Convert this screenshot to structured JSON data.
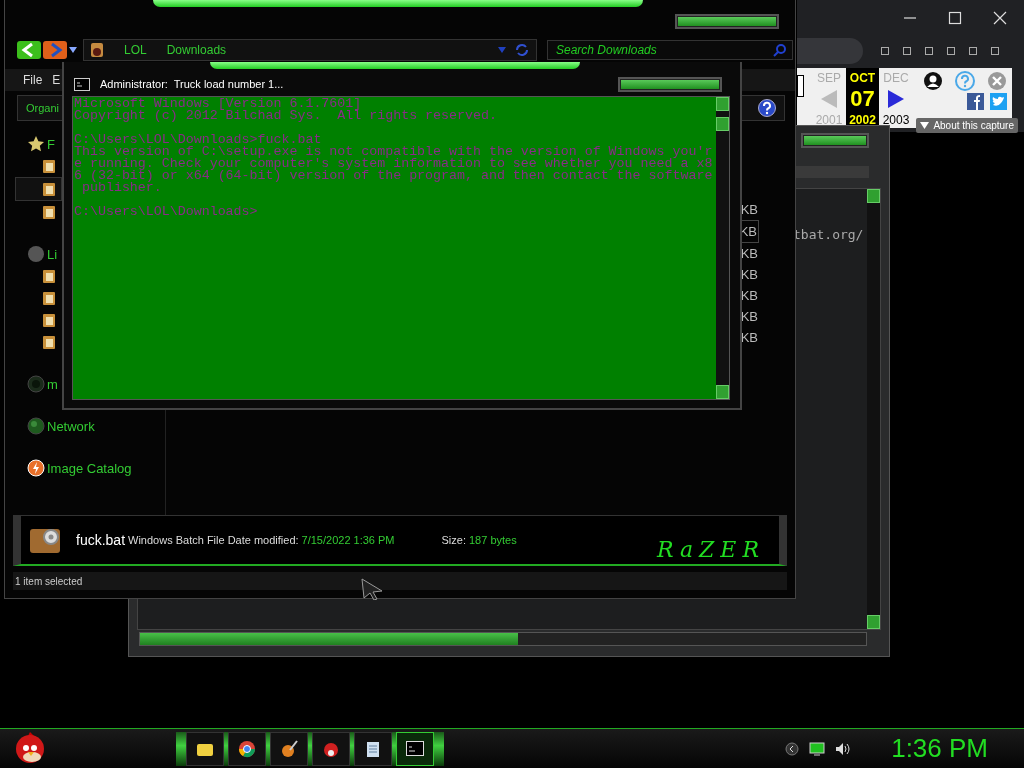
{
  "browser": {
    "wayback": {
      "months": [
        {
          "label": "SEP",
          "selected": false
        },
        {
          "label": "OCT",
          "selected": true
        },
        {
          "label": "DEC",
          "selected": false
        }
      ],
      "day": "07",
      "years": [
        {
          "label": "2001",
          "selected": false
        },
        {
          "label": "2002",
          "selected": true
        },
        {
          "label": "2003",
          "selected": false
        }
      ],
      "about": "About this capture"
    }
  },
  "back_window": {
    "text": "tbat.org/"
  },
  "explorer": {
    "address": [
      "LOL",
      "Downloads"
    ],
    "search": {
      "placeholder": "Search Downloads"
    },
    "menu": [
      "File",
      "E"
    ],
    "toolbar": [
      "Organi"
    ],
    "sidebar": [
      {
        "label": "F",
        "kind": "favorites",
        "items": [
          {
            "selected": false
          },
          {
            "selected": true
          },
          {
            "selected": false
          }
        ]
      },
      {
        "label": "Li",
        "kind": "libraries",
        "items": [
          {
            "selected": false
          },
          {
            "selected": false
          },
          {
            "selected": false
          },
          {
            "selected": false
          }
        ]
      },
      {
        "label": "m",
        "kind": "homegroup"
      },
      {
        "label": "Network",
        "kind": "network"
      },
      {
        "label": "Image Catalog",
        "kind": "catalog"
      }
    ],
    "sizes": [
      {
        "text": "KB",
        "selected": false
      },
      {
        "text": "KB",
        "selected": true
      },
      {
        "text": "KB",
        "selected": false
      },
      {
        "text": "KB",
        "selected": false
      },
      {
        "text": "KB",
        "selected": false
      },
      {
        "text": "KB",
        "selected": false
      },
      {
        "text": "KB",
        "selected": false
      }
    ],
    "details": {
      "name": "fuck.bat",
      "type": "Windows Batch File",
      "date_label": "Date modified:",
      "date": "7/15/2022 1:36 PM",
      "size_label": "Size:",
      "size": "187 bytes",
      "logo": "RaZER"
    },
    "status": "1 item selected"
  },
  "console": {
    "title": "Administrator:  Truck load number 1...",
    "blocks": [
      [
        "Microsoft Windows [Version 6.1.7601]",
        "Copyright (c) 2012 Bilchad Sys.  All rights reserved."
      ],
      [
        "C:\\Users\\LOL\\Downloads>fuck.bat",
        "This version of C:\\setup.exe is not compatible with the version of Windows you'r",
        "e running. Check your computer's system information to see whether you need a x8",
        "6 (32-bit) or x64 (64-bit) version of the program, and then contact the software",
        " publisher."
      ],
      [
        "C:\\Users\\LOL\\Downloads>"
      ]
    ]
  },
  "taskbar": {
    "apps": [
      {
        "kind": "folder",
        "selected": false
      },
      {
        "kind": "browser",
        "selected": false
      },
      {
        "kind": "paint",
        "selected": false
      },
      {
        "kind": "bird",
        "selected": false
      },
      {
        "kind": "notepad",
        "selected": false
      },
      {
        "kind": "console",
        "selected": true
      }
    ],
    "clock": "1:36 PM"
  }
}
